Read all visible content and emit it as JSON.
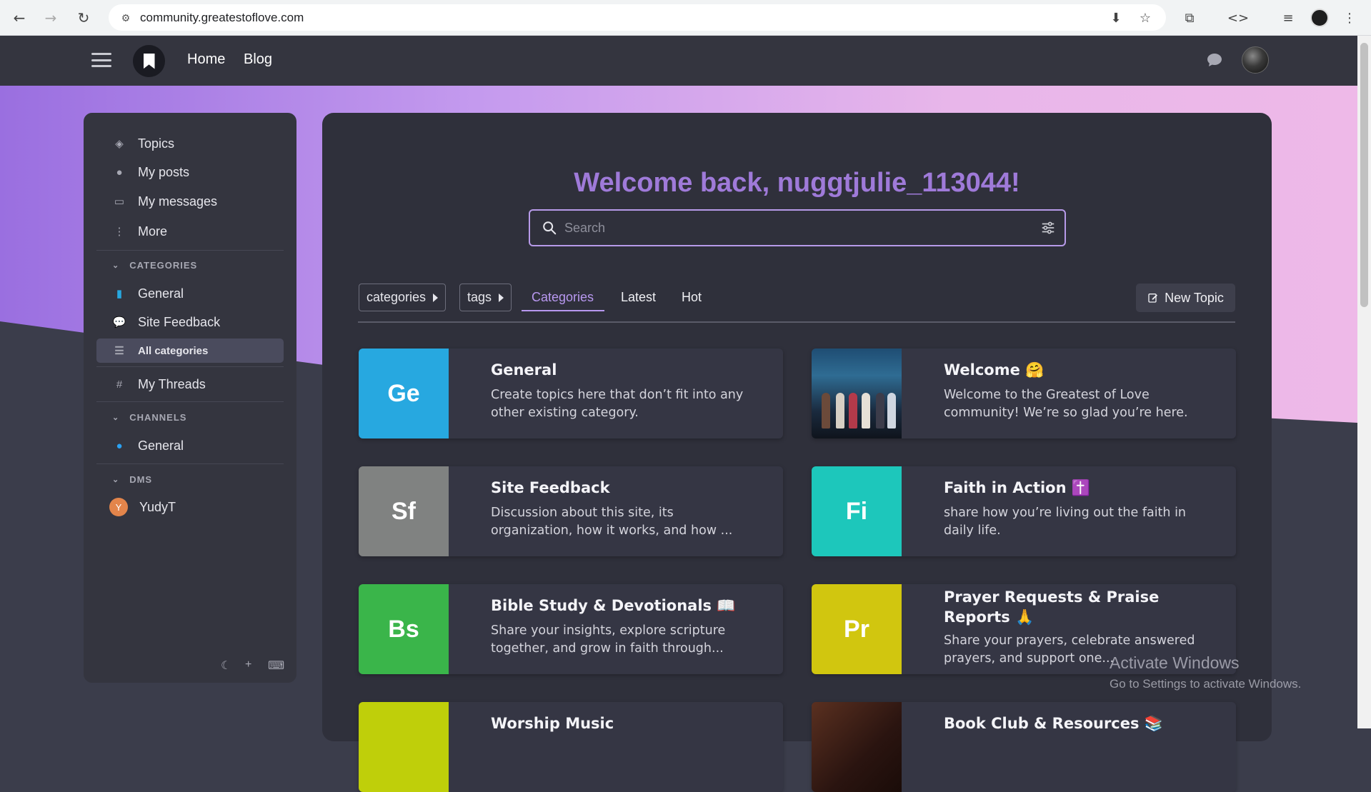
{
  "browser": {
    "url": "community.greatestoflove.com"
  },
  "header": {
    "nav": [
      "Home",
      "Blog"
    ]
  },
  "sidebar": {
    "items": [
      {
        "label": "Topics",
        "icon": "layers-icon"
      },
      {
        "label": "My posts",
        "icon": "user-icon"
      },
      {
        "label": "My messages",
        "icon": "inbox-icon"
      },
      {
        "label": "More",
        "icon": "ellipsis-vertical-icon"
      }
    ],
    "categories_heading": "CATEGORIES",
    "categories": [
      {
        "label": "General",
        "icon": "book-icon",
        "color": "#0088cc"
      },
      {
        "label": "Site Feedback",
        "icon": "speech-bubbles-icon",
        "color": "#808281"
      }
    ],
    "all_categories": "All categories",
    "threads": "My Threads",
    "channels_heading": "CHANNELS",
    "channels": [
      {
        "label": "General",
        "icon": "chat-bubble-icon",
        "color": "#2aa1f2"
      }
    ],
    "dms_heading": "DMS",
    "dms": [
      {
        "label": "YudyT",
        "initial": "Y",
        "color": "#e3854b"
      }
    ]
  },
  "main": {
    "welcome": "Welcome back, nuggtjulie_113044!",
    "search_placeholder": "Search",
    "filters": {
      "categories": "categories",
      "tags": "tags"
    },
    "tabs": [
      "Categories",
      "Latest",
      "Hot"
    ],
    "active_tab": "Categories",
    "new_topic": "New Topic",
    "cards": [
      {
        "tile": "Ge",
        "color": "#27a8e0",
        "title": "General",
        "desc": "Create topics here that don’t fit into any other existing category."
      },
      {
        "tile": "",
        "image": "group-photo",
        "title": "Welcome 🤗",
        "desc": "Welcome to the Greatest of Love community! We’re so glad you’re here."
      },
      {
        "tile": "Sf",
        "color": "#808281",
        "title": "Site Feedback",
        "desc": "Discussion about this site, its organization, how it works, and how ..."
      },
      {
        "tile": "Fi",
        "color": "#1dc7bb",
        "title": "Faith in Action ✝️",
        "desc": "share how you’re living out the faith in daily life."
      },
      {
        "tile": "Bs",
        "color": "#3ab54a",
        "title": "Bible Study & Devotionals 📖",
        "desc": "Share your insights, explore scripture together, and grow in faith through..."
      },
      {
        "tile": "Pr",
        "color": "#d1c60f",
        "title": "Prayer Requests & Praise Reports 🙏",
        "desc": "Share your prayers, celebrate answered prayers, and support one..."
      },
      {
        "tile": "",
        "color": "#bfcf0a",
        "title": "Worship Music",
        "desc": ""
      },
      {
        "tile": "",
        "image": "books-photo",
        "title": "Book Club & Resources 📚",
        "desc": ""
      }
    ]
  },
  "watermark": {
    "line1": "Activate Windows",
    "line2": "Go to Settings to activate Windows."
  }
}
